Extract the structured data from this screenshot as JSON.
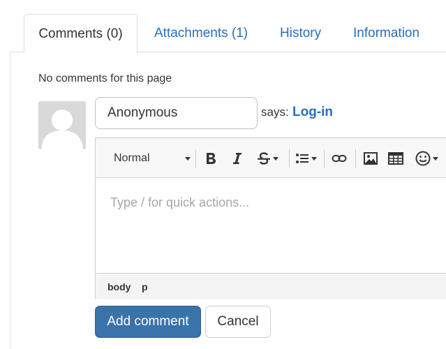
{
  "tabs": [
    {
      "label": "Comments (0)",
      "active": true
    },
    {
      "label": "Attachments (1)",
      "active": false
    },
    {
      "label": "History",
      "active": false
    },
    {
      "label": "Information",
      "active": false
    }
  ],
  "comments": {
    "empty_message": "No comments for this page",
    "avatar_icon": "user-silhouette-icon",
    "name_value": "Anonymous",
    "says_text": "says:",
    "login_link": "Log-in"
  },
  "editor": {
    "format_value": "Normal",
    "toolbar_icons": [
      "bold-icon",
      "italic-icon",
      "strikethrough-icon",
      "list-icon",
      "link-icon",
      "image-icon",
      "table-icon",
      "emoji-icon"
    ],
    "placeholder": "Type / for quick actions...",
    "path": [
      "body",
      "p"
    ]
  },
  "actions": {
    "submit_label": "Add comment",
    "cancel_label": "Cancel"
  },
  "colors": {
    "link": "#2a6ebb",
    "primary_button": "#3a72aa",
    "avatar_bg": "#d9d9d9"
  }
}
